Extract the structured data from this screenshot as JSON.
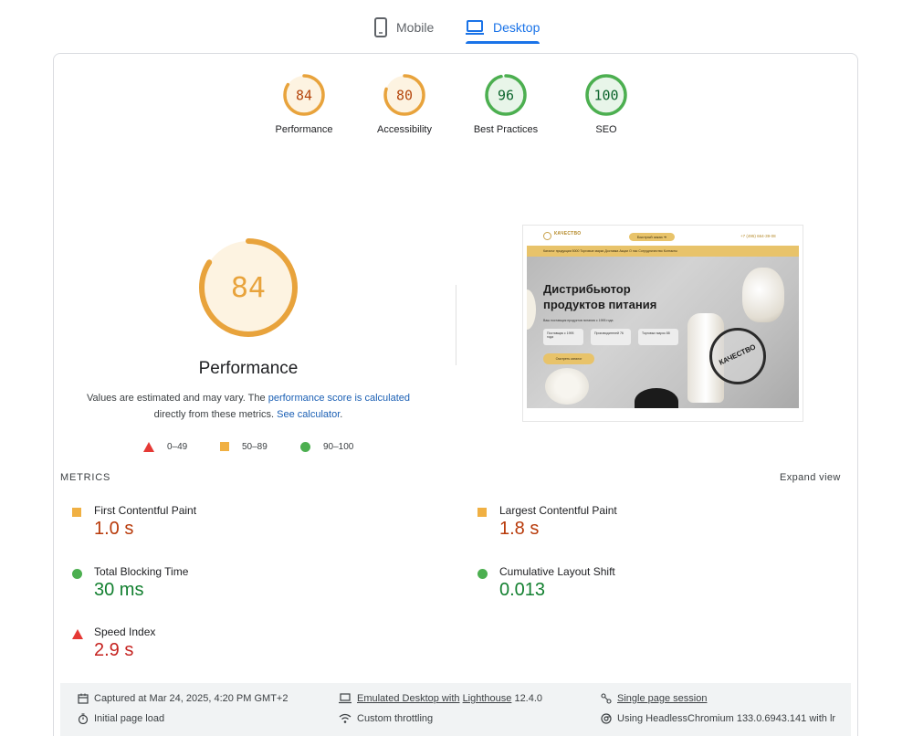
{
  "tabs": [
    {
      "label": "Mobile",
      "icon": "phone-icon",
      "active": false
    },
    {
      "label": "Desktop",
      "icon": "laptop-icon",
      "active": true
    }
  ],
  "categories": [
    {
      "score": "84",
      "label": "Performance",
      "fraction": 0.84,
      "color": "#e8a33c",
      "bg": "#fdf3e1"
    },
    {
      "score": "80",
      "label": "Accessibility",
      "fraction": 0.8,
      "color": "#e8a33c",
      "bg": "#fdf3e1"
    },
    {
      "score": "96",
      "label": "Best Practices",
      "fraction": 0.96,
      "color": "#4caf50",
      "bg": "#e8f5e9"
    },
    {
      "score": "100",
      "label": "SEO",
      "fraction": 1.0,
      "color": "#4caf50",
      "bg": "#e8f5e9"
    }
  ],
  "performance": {
    "score": "84",
    "fraction": 0.84,
    "title": "Performance",
    "desc_prefix": "Values are estimated and may vary. The ",
    "desc_link1": "performance score is calculated",
    "desc_mid": " directly from these metrics. ",
    "desc_link2": "See calculator",
    "desc_suffix": "."
  },
  "legend": [
    {
      "range": "0–49",
      "shape": "triangle",
      "color": "#e53935"
    },
    {
      "range": "50–89",
      "shape": "square",
      "color": "#f0b043"
    },
    {
      "range": "90–100",
      "shape": "circle",
      "color": "#4caf50"
    }
  ],
  "screenshot": {
    "logo_text": "КАЧЕСТВО",
    "quick_order": "Быстрый заказ ➜",
    "phone": "+7 (495) 664-39-08",
    "nav": "Каталог продукции 5000   Торговые марки   Доставка   Акции   О нас   Сотрудничество   Контакты",
    "headline_1": "Дистрибьютор",
    "headline_2": "продуктов питания",
    "subline": "Ваш поставщик продуктов питания с 1995 года",
    "chip_1": "Поставщик с 1995 года",
    "chip_2": "Производителей 76",
    "chip_3": "Торговых марок 88",
    "catalog_btn": "Смотреть каталог",
    "stamp": "КАЧЕСТВО"
  },
  "metrics": {
    "heading": "METRICS",
    "expand_label": "Expand view",
    "items": [
      {
        "name": "First Contentful Paint",
        "value": "1.0 s",
        "status": "average"
      },
      {
        "name": "Largest Contentful Paint",
        "value": "1.8 s",
        "status": "average"
      },
      {
        "name": "Total Blocking Time",
        "value": "30 ms",
        "status": "pass"
      },
      {
        "name": "Cumulative Layout Shift",
        "value": "0.013",
        "status": "pass"
      },
      {
        "name": "Speed Index",
        "value": "2.9 s",
        "status": "fail"
      }
    ]
  },
  "footer": {
    "captured": "Captured at Mar 24, 2025, 4:20 PM GMT+2",
    "emulated_link": "Emulated Desktop with",
    "emulated_link2": "Lighthouse",
    "emulated_version": " 12.4.0",
    "session": "Single page session",
    "initial_load": "Initial page load",
    "throttling": "Custom throttling",
    "browser": "Using HeadlessChromium 133.0.6943.141 with lr"
  }
}
